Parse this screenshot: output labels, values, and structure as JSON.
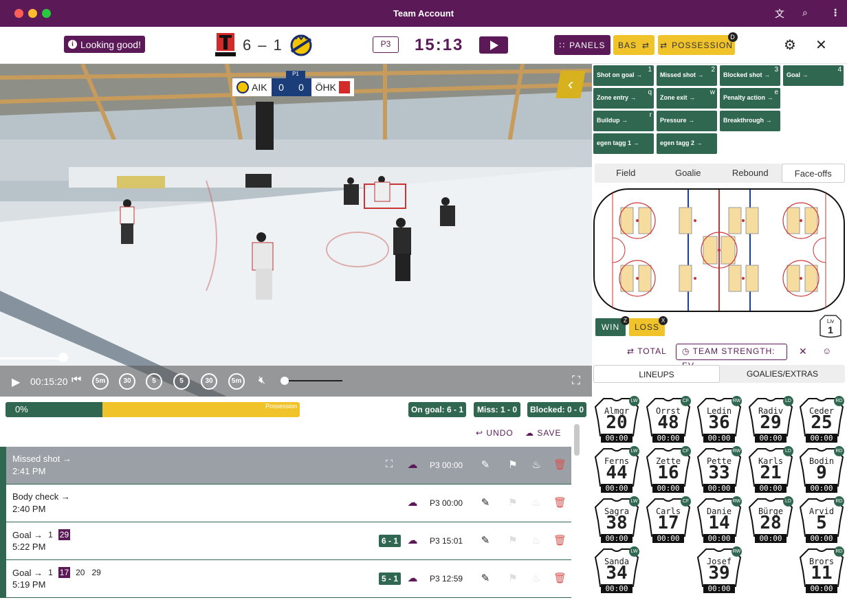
{
  "window": {
    "title": "Team Account"
  },
  "header": {
    "status": "Looking good!",
    "score_home": "6",
    "score_sep": "–",
    "score_away": "1",
    "period": "P3",
    "clock": "15:13",
    "panels_label": "PANELS",
    "bas_label": "BAS",
    "possession_label": "POSSESSION",
    "possession_key": "D"
  },
  "video": {
    "scorebug": {
      "team_left": "AIK",
      "score_left": "0",
      "score_right": "0",
      "team_right": "ÖHK",
      "period": "P1"
    },
    "time": "00:15:20",
    "skip_labels": [
      "5m",
      "30",
      "5",
      "5",
      "30",
      "5m"
    ]
  },
  "possession": {
    "percent": "0%",
    "label": "Possession",
    "fill_fraction": 0.33
  },
  "stats": {
    "on_goal": "On goal: 6 - 1",
    "miss": "Miss: 1 - 0",
    "blocked": "Blocked: 0 - 0"
  },
  "actions": {
    "undo": "UNDO",
    "save": "SAVE"
  },
  "events": [
    {
      "title": "Missed shot →",
      "time": "2:41 PM",
      "period": "P3 00:00",
      "numbers": [],
      "score": ""
    },
    {
      "title": "Body check →",
      "time": "2:40 PM",
      "period": "P3 00:00",
      "numbers": [],
      "score": ""
    },
    {
      "title": "Goal →",
      "time": "5:22 PM",
      "period": "P3 15:01",
      "numbers": [
        "1",
        "29"
      ],
      "score": "6 - 1"
    },
    {
      "title": "Goal →",
      "time": "5:19 PM",
      "period": "P3 12:59",
      "numbers": [
        "1",
        "17",
        "20",
        "29"
      ],
      "score": "5 - 1"
    }
  ],
  "event_buttons": [
    {
      "label": "Shot on goal →",
      "key": "1"
    },
    {
      "label": "Missed shot →",
      "key": "2"
    },
    {
      "label": "Blocked shot →",
      "key": "3"
    },
    {
      "label": "Goal →",
      "key": "4"
    },
    {
      "label": "Zone entry →",
      "key": "q"
    },
    {
      "label": "Zone exit →",
      "key": "w"
    },
    {
      "label": "Penalty action →",
      "key": "e"
    },
    {
      "label": "Buildup →",
      "key": "r"
    },
    {
      "label": "Pressure →",
      "key": ""
    },
    {
      "label": "Breakthrough →",
      "key": ""
    },
    {
      "label": "egen tagg 1 →",
      "key": ""
    },
    {
      "label": "egen tagg 2 →",
      "key": ""
    }
  ],
  "field_tabs": [
    "Field",
    "Goalie",
    "Rebound",
    "Face-offs"
  ],
  "faceoff": {
    "win": "WIN",
    "win_key": "Z",
    "loss": "LOSS",
    "loss_key": "X",
    "liv_label": "Liv",
    "liv_num": "1"
  },
  "strength": {
    "total": "TOTAL",
    "team_strength": "TEAM STRENGTH: EV"
  },
  "lineup_tabs": [
    "LINEUPS",
    "GOALIES/EXTRAS"
  ],
  "players": [
    {
      "name": "Almgr",
      "num": "20",
      "pos": "LW",
      "time": "00:00"
    },
    {
      "name": "Orrst",
      "num": "48",
      "pos": "CF",
      "time": "00:00"
    },
    {
      "name": "Ledin",
      "num": "36",
      "pos": "RW",
      "time": "00:00"
    },
    {
      "name": "Radiv",
      "num": "29",
      "pos": "LD",
      "time": "00:00"
    },
    {
      "name": "Ceder",
      "num": "25",
      "pos": "RD",
      "time": "00:00"
    },
    {
      "name": "Ferns",
      "num": "44",
      "pos": "LW",
      "time": "00:00"
    },
    {
      "name": "Zette",
      "num": "16",
      "pos": "CF",
      "time": "00:00"
    },
    {
      "name": "Pette",
      "num": "33",
      "pos": "RW",
      "time": "00:00"
    },
    {
      "name": "Karls",
      "num": "21",
      "pos": "LD",
      "time": "00:00"
    },
    {
      "name": "Bodin",
      "num": "9",
      "pos": "RD",
      "time": "00:00"
    },
    {
      "name": "Sagra",
      "num": "38",
      "pos": "LW",
      "time": "00:00"
    },
    {
      "name": "Carls",
      "num": "17",
      "pos": "CF",
      "time": "00:00"
    },
    {
      "name": "Danie",
      "num": "14",
      "pos": "RW",
      "time": "00:00"
    },
    {
      "name": "Bürge",
      "num": "28",
      "pos": "LD",
      "time": "00:00"
    },
    {
      "name": "Arvid",
      "num": "5",
      "pos": "RD",
      "time": "00:00"
    },
    {
      "name": "Sanda",
      "num": "34",
      "pos": "LW",
      "time": "00:00"
    },
    {
      "name": "Josef",
      "num": "39",
      "pos": "RW",
      "time": "00:00"
    },
    {
      "name": "Brors",
      "num": "11",
      "pos": "RD",
      "time": "00:00"
    }
  ],
  "colors": {
    "brand": "#5b1a57",
    "green": "#2f6750",
    "yellow": "#f0c32a"
  }
}
